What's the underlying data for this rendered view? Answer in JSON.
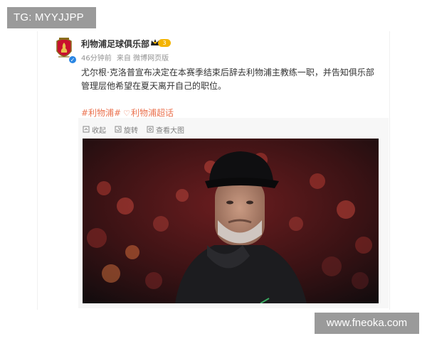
{
  "watermark": {
    "tg_handle": "TG: MYYJJPP",
    "site_url": "www.fneoka.com"
  },
  "post": {
    "account_name": "利物浦足球俱乐部",
    "level_badge": "3",
    "time_ago": "46分钟前",
    "source": "来自 微博网页版",
    "text": "尤尔根·克洛普宣布决定在本赛季结束后辞去利物浦主教练一职，并告知俱乐部管理层他希望在夏天离开自己的职位。",
    "hashtags": [
      "#利物浦#",
      "利物浦超话"
    ],
    "verified_mark": "✓"
  },
  "media_toolbar": {
    "collapse_label": "收起",
    "rotate_label": "旋转",
    "view_large_label": "查看大图"
  },
  "photo": {
    "subject": "man in black cap and dark jacket, stadium crowd in red behind",
    "icons": [
      "avatar-crest",
      "crown-icon"
    ]
  },
  "colors": {
    "hashtag": "#eb7350",
    "verified": "#2a86e3",
    "badge": "#f4b400"
  }
}
